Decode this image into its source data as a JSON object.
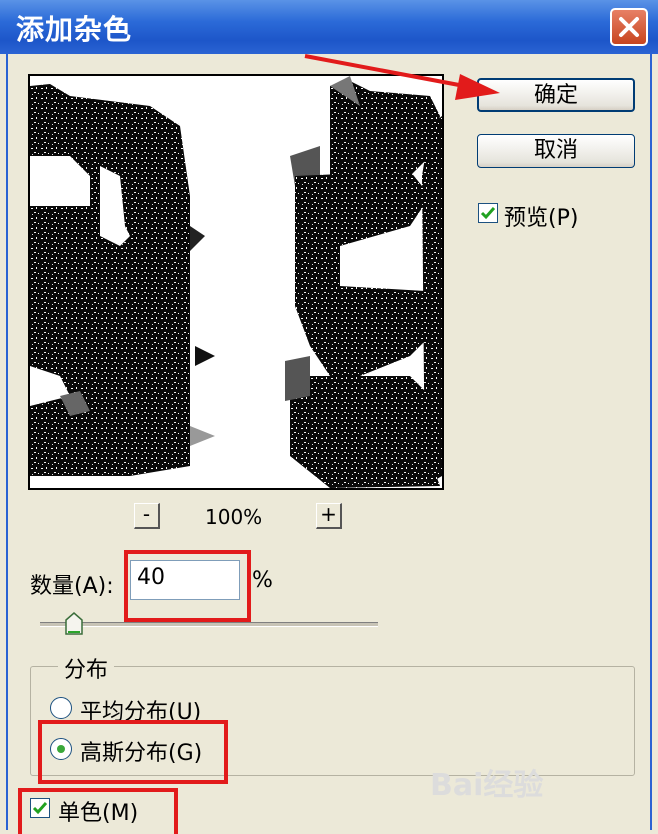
{
  "window": {
    "title": "添加杂色"
  },
  "buttons": {
    "ok": "确定",
    "cancel": "取消"
  },
  "preview": {
    "checkbox_label": "预览(P)",
    "checked": true,
    "zoom": "100%",
    "zoom_out": "-",
    "zoom_in": "+"
  },
  "amount": {
    "label": "数量(A):",
    "value": "40",
    "unit": "%"
  },
  "distribution": {
    "group_label": "分布",
    "options": [
      {
        "label": "平均分布(U)",
        "selected": false
      },
      {
        "label": "高斯分布(G)",
        "selected": true
      }
    ]
  },
  "monochromatic": {
    "label": "单色(M)",
    "checked": true
  },
  "watermark": "Bai经验",
  "colors": {
    "titlebar": "#2b6ad8",
    "annotation": "#e21b1b",
    "check": "#21a121"
  }
}
